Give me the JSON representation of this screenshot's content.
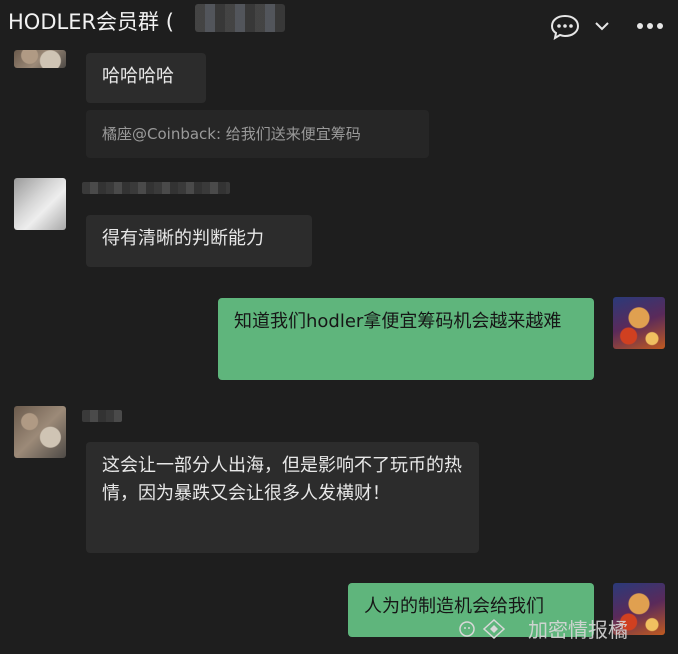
{
  "header": {
    "title": "HODLER会员群 (",
    "chat_icon": "chat-bubble-icon",
    "dropdown_icon": "chevron-down-icon",
    "more_icon": "more-dots-icon"
  },
  "messages": [
    {
      "type": "text",
      "direction": "in",
      "text": "哈哈哈哈"
    },
    {
      "type": "quote",
      "text": "橘座@Coinback: 给我们送来便宜筹码"
    },
    {
      "type": "text",
      "direction": "in",
      "text": "得有清晰的判断能力"
    },
    {
      "type": "text",
      "direction": "out",
      "text": "知道我们hodler拿便宜筹码机会越来越难"
    },
    {
      "type": "text",
      "direction": "in",
      "text": "这会让一部分人出海，但是影响不了玩币的热情，因为暴跌又会让很多人发横财！"
    },
    {
      "type": "text",
      "direction": "out",
      "text": "人为的制造机会给我们"
    }
  ],
  "watermark": {
    "text": "加密情报橘"
  },
  "colors": {
    "background": "#1e1e1e",
    "incoming": "#2c2c2c",
    "outgoing": "#5fb57c"
  }
}
